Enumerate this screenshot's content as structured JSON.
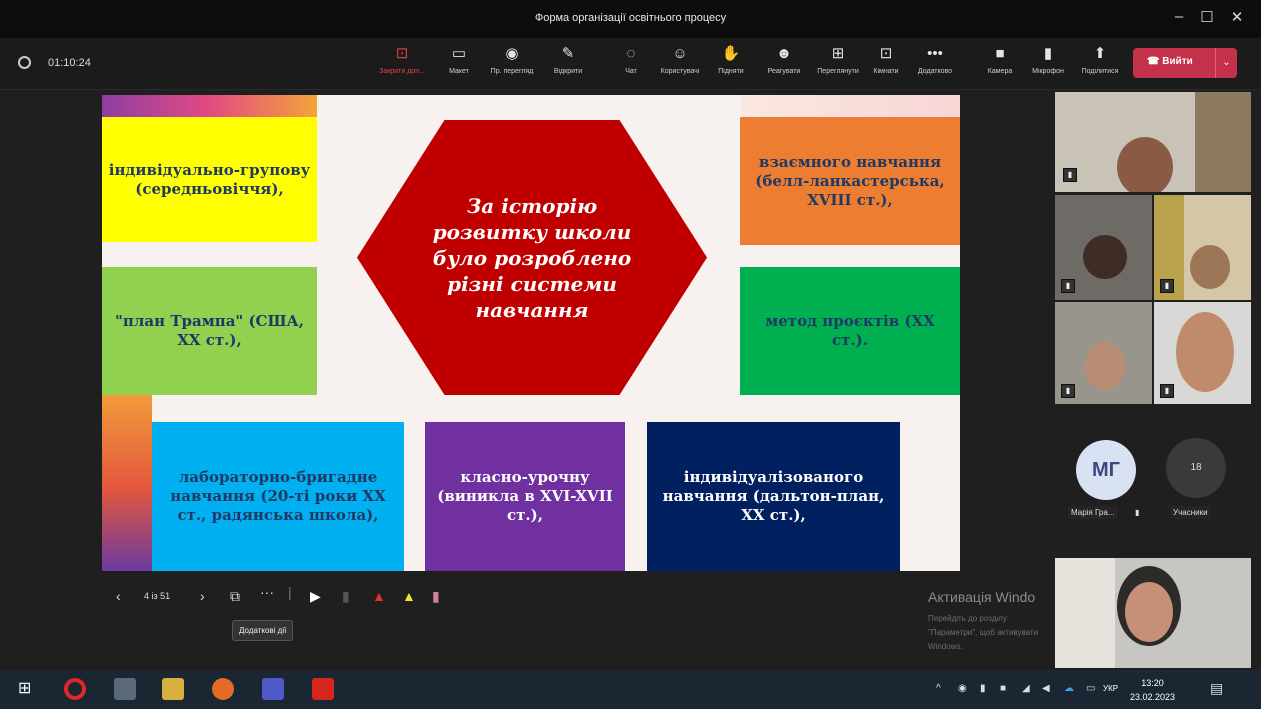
{
  "window": {
    "title": "Форма організації освітнього процесу",
    "controls": [
      "–",
      "☐",
      "✕"
    ]
  },
  "toolbar": {
    "timer": "01:10:24",
    "buttons": [
      {
        "icon": "share-stop-icon",
        "glyph": "⊡",
        "label": "Закрити доп..."
      },
      {
        "icon": "layout-icon",
        "glyph": "▭",
        "label": "Макет"
      },
      {
        "icon": "view-icon",
        "glyph": "◉",
        "label": "Пр. перегляд"
      },
      {
        "icon": "whiteboard-icon",
        "glyph": "✎",
        "label": "Відкрити"
      },
      {
        "icon": "chat-icon",
        "glyph": "◌",
        "label": "Чат"
      },
      {
        "icon": "people-icon",
        "glyph": "☺",
        "label": "Користувачі"
      },
      {
        "icon": "raise-hand-icon",
        "glyph": "✋",
        "label": "Підняти"
      },
      {
        "icon": "react-icon",
        "glyph": "☻",
        "label": "Реагувати"
      },
      {
        "icon": "rooms-icon",
        "glyph": "⊞",
        "label": "Переглянути"
      },
      {
        "icon": "apps-icon",
        "glyph": "⊡",
        "label": "Кімнати"
      },
      {
        "icon": "more-icon",
        "glyph": "•••",
        "label": "Додатково"
      },
      {
        "icon": "camera-icon",
        "glyph": "■",
        "label": "Камера"
      },
      {
        "icon": "microphone-icon",
        "glyph": "▮",
        "label": "Мікрофон"
      },
      {
        "icon": "share-icon",
        "glyph": "⬆",
        "label": "Поділитися"
      }
    ],
    "leave_label": "Вийти"
  },
  "slide": {
    "center_text": "За історію розвитку школи було розроблено різні системи навчання",
    "boxes": {
      "individual_group": "індивідуально-групову (середньовіччя),",
      "trump_plan": "\"план Трампа\" (США, XX ст.),",
      "lab_brigade": "лабораторно-бригадне навчання (20-ті роки XX ст., радянська школа),",
      "class_lesson": "класно-урочну (виникла в XVI-XVII ст.),",
      "individualized": "індивідуалізованого навчання (дальтон-план, XX ст.),",
      "mutual": "взаємного навчання (белл-ланкастерська, XVIII ст.),",
      "projects": "метод проєктів (XX ст.)."
    },
    "colors": {
      "yellow": "#ffff00",
      "green": "#92d050",
      "blue": "#00b0f0",
      "purple": "#7030a0",
      "navy": "#002060",
      "orange": "#ed7d31",
      "emerald": "#00b050",
      "red": "#c00000"
    }
  },
  "slide_controls": {
    "page": "4 із 51",
    "tooltip": "Додаткові дії"
  },
  "watermark": {
    "title": "Активація Windo",
    "subtitle": "Перейдіть до розділу \"Параметри\", щоб активувати Windows."
  },
  "participants": {
    "avatar_initials": "МГ",
    "avatar_name": "Марія Гра...",
    "count": "18",
    "count_label": "Учасники"
  },
  "taskbar": {
    "time": "13:20",
    "date": "23.02.2023",
    "lang": "УКР"
  }
}
